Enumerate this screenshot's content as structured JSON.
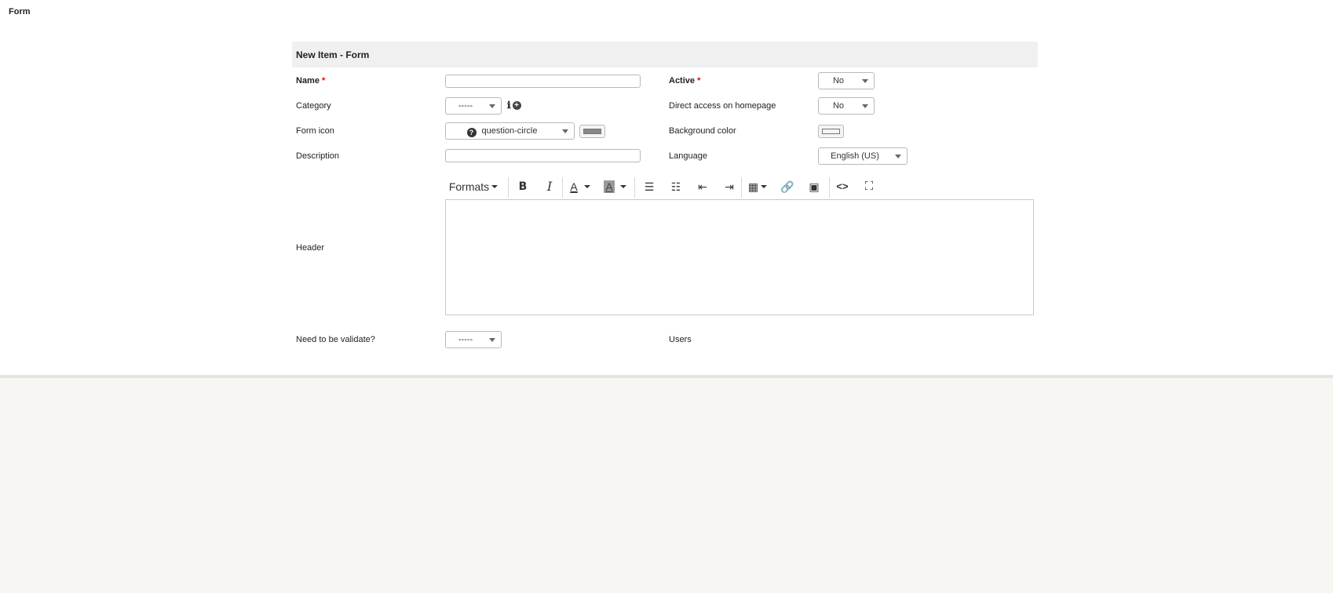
{
  "page": {
    "title": "Form"
  },
  "panel": {
    "title": "New Item - Form"
  },
  "fields": {
    "name": {
      "label": "Name",
      "required": "*",
      "value": ""
    },
    "active": {
      "label": "Active",
      "required": "*",
      "value": "No"
    },
    "category": {
      "label": "Category",
      "value": "-----"
    },
    "direct_access": {
      "label": "Direct access on homepage",
      "value": "No"
    },
    "form_icon": {
      "label": "Form icon",
      "value": "question-circle",
      "icon": "question-circle-icon",
      "color": "#888888"
    },
    "background_color": {
      "label": "Background color",
      "color": "#f4f4f4"
    },
    "description": {
      "label": "Description",
      "value": ""
    },
    "language": {
      "label": "Language",
      "value": "English (US)"
    },
    "header": {
      "label": "Header",
      "content": ""
    },
    "need_validate": {
      "label": "Need to be validate?",
      "value": "-----"
    },
    "users": {
      "label": "Users"
    }
  },
  "editor_toolbar": {
    "formats_label": "Formats",
    "buttons": [
      "bold",
      "italic",
      "text-color",
      "background-color",
      "bullet-list",
      "numbered-list",
      "outdent",
      "indent",
      "table",
      "link",
      "image",
      "source-code",
      "fullscreen"
    ]
  },
  "colors": {
    "required": "#ee0000",
    "panel_header_bg": "#f0f0f0",
    "page_bg": "#f7f6f3"
  }
}
